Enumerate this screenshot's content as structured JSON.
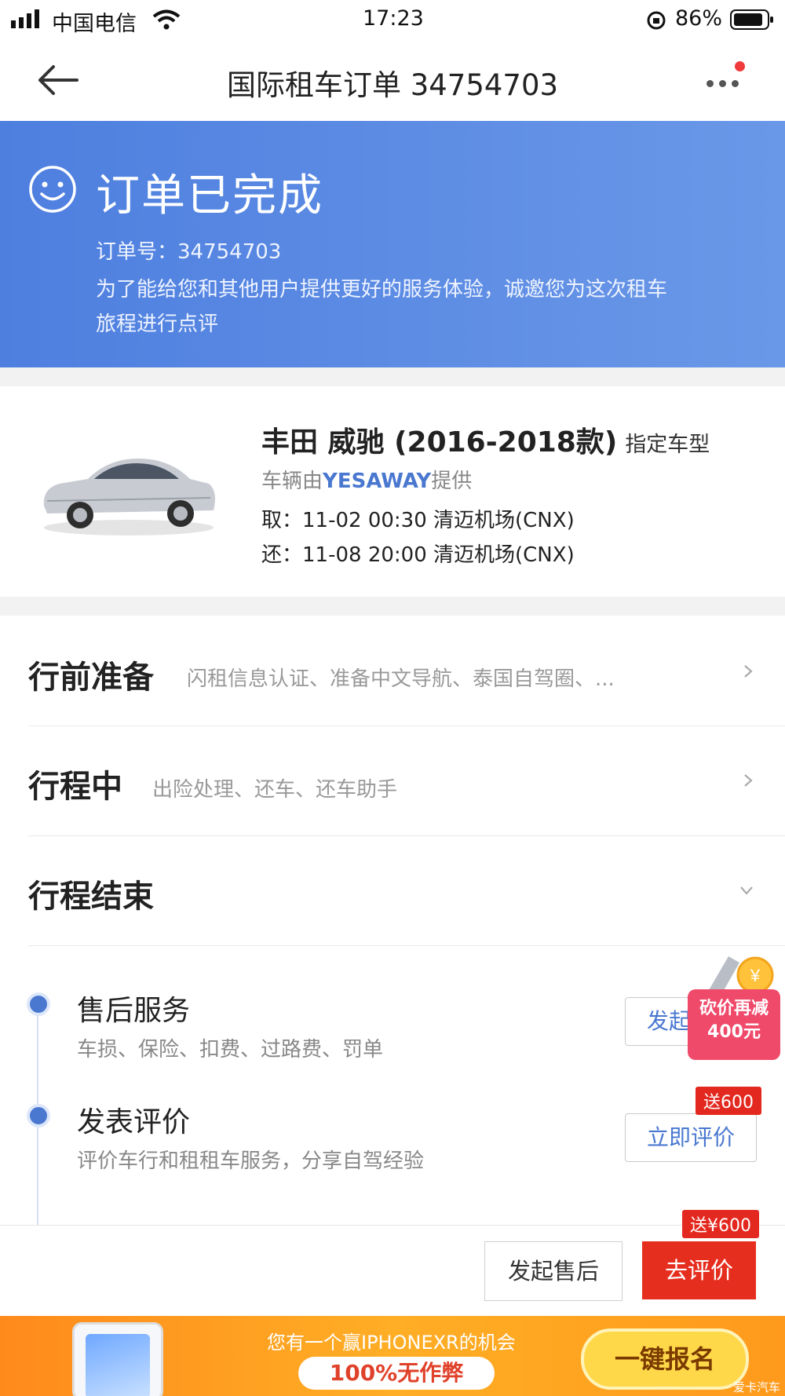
{
  "status_bar": {
    "carrier": "中国电信",
    "time": "17:23",
    "battery": "86%"
  },
  "nav": {
    "title": "国际租车订单 34754703"
  },
  "banner": {
    "status": "订单已完成",
    "order_no": "订单号：34754703",
    "invite_line1": "为了能给您和其他用户提供更好的服务体验，诚邀您为这次租车",
    "invite_line2": "旅程进行点评",
    "bg_color": "#5a89e2"
  },
  "car": {
    "name": "丰田 威驰 (2016-2018款)",
    "tag": "指定车型",
    "provider_prefix": "车辆由",
    "provider": "YESAWAY",
    "provider_suffix": "提供",
    "pickup": "取：11-02 00:30 清迈机场(CNX)",
    "return": "还：11-08 20:00 清迈机场(CNX)"
  },
  "sections": [
    {
      "title": "行前准备",
      "subtitle": "闪租信息认证、准备中文导航、泰国自驾圈、...",
      "icon": "chevron-right-icon"
    },
    {
      "title": "行程中",
      "subtitle": "出险处理、还车、还车助手",
      "icon": "chevron-right-icon"
    },
    {
      "title": "行程结束",
      "subtitle": "",
      "icon": "chevron-down-icon"
    }
  ],
  "timeline": [
    {
      "title": "售后服务",
      "subtitle": "车损、保险、扣费、过路费、罚单",
      "button": "发起"
    },
    {
      "title": "发表评价",
      "subtitle": "评价车行和租租车服务，分享自驾经验",
      "button": "立即评价",
      "badge": "送600"
    }
  ],
  "promo": {
    "line1": "砍价再减",
    "line2": "400元"
  },
  "action_bar": {
    "after_sale": "发起售后",
    "review": "去评价",
    "badge": "送¥600",
    "accent": "#e62e1f"
  },
  "ad": {
    "line1": "您有一个赢IPHONEXR的机会",
    "pill": "100%无作弊",
    "cta": "一键报名",
    "watermark": "爱卡汽车"
  }
}
